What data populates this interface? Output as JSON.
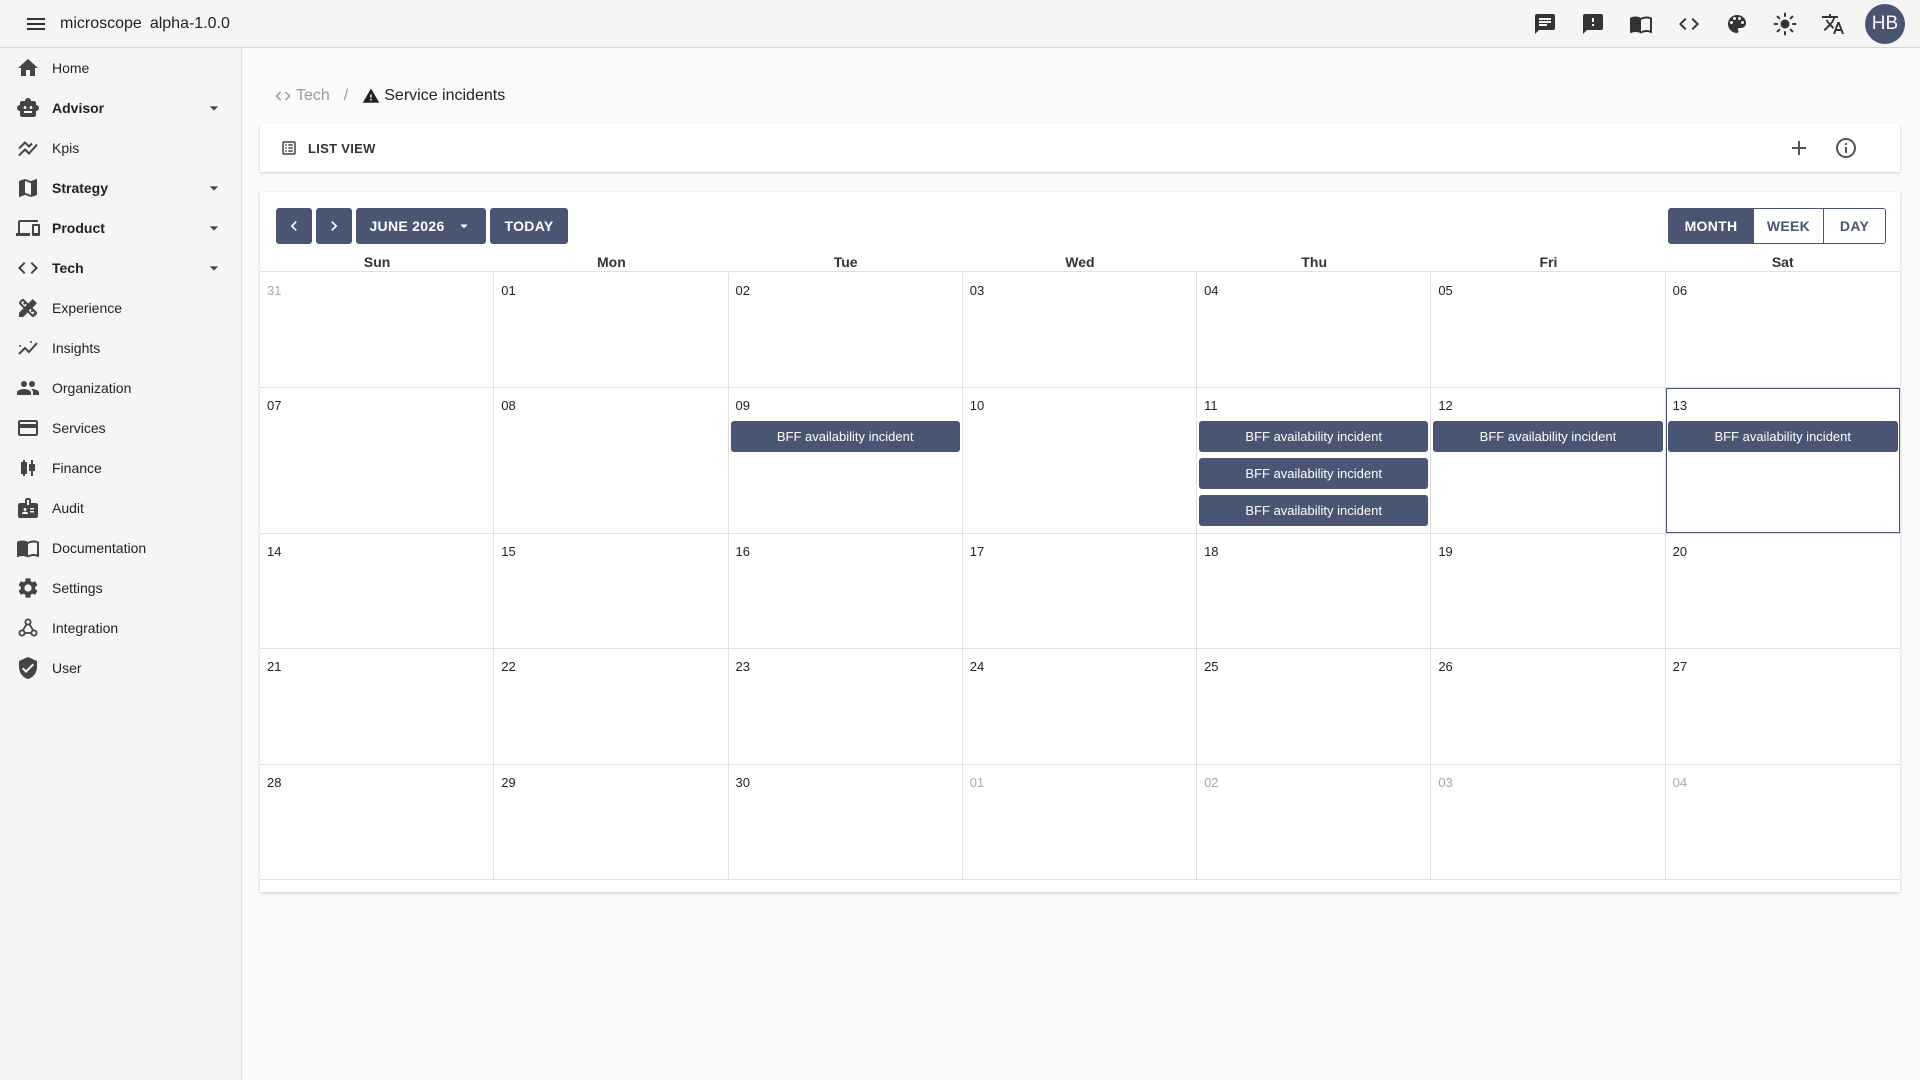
{
  "app": {
    "title": "microscope",
    "version": "alpha-1.0.0",
    "user_initials": "HB"
  },
  "topbar_icons": [
    "chat-icon",
    "feedback-icon",
    "book-icon",
    "code-icon",
    "palette-icon",
    "brightness-icon",
    "translate-icon"
  ],
  "sidebar": {
    "items": [
      {
        "label": "Home",
        "icon": "home-icon",
        "bold": false,
        "expandable": false
      },
      {
        "label": "Advisor",
        "icon": "robot-icon",
        "bold": true,
        "expandable": true
      },
      {
        "label": "Kpis",
        "icon": "kpi-chart-icon",
        "bold": false,
        "expandable": false
      },
      {
        "label": "Strategy",
        "icon": "map-icon",
        "bold": true,
        "expandable": true
      },
      {
        "label": "Product",
        "icon": "devices-icon",
        "bold": true,
        "expandable": true
      },
      {
        "label": "Tech",
        "icon": "code-icon",
        "bold": true,
        "expandable": true
      },
      {
        "label": "Experience",
        "icon": "design-tools-icon",
        "bold": false,
        "expandable": false
      },
      {
        "label": "Insights",
        "icon": "insights-icon",
        "bold": false,
        "expandable": false
      },
      {
        "label": "Organization",
        "icon": "people-icon",
        "bold": false,
        "expandable": false
      },
      {
        "label": "Services",
        "icon": "card-icon",
        "bold": false,
        "expandable": false
      },
      {
        "label": "Finance",
        "icon": "candlestick-icon",
        "bold": false,
        "expandable": false
      },
      {
        "label": "Audit",
        "icon": "badge-icon",
        "bold": false,
        "expandable": false
      },
      {
        "label": "Documentation",
        "icon": "book-icon",
        "bold": false,
        "expandable": false
      },
      {
        "label": "Settings",
        "icon": "gear-icon",
        "bold": false,
        "expandable": false
      },
      {
        "label": "Integration",
        "icon": "webhook-icon",
        "bold": false,
        "expandable": false
      },
      {
        "label": "User",
        "icon": "shield-icon",
        "bold": false,
        "expandable": false
      }
    ]
  },
  "breadcrumb": {
    "parent": "Tech",
    "separator": "/",
    "current": "Service incidents"
  },
  "toolbar": {
    "list_view_label": "LIST VIEW"
  },
  "calendar": {
    "month_label": "JUNE 2026",
    "today_label": "TODAY",
    "views": [
      {
        "label": "MONTH",
        "active": true
      },
      {
        "label": "WEEK",
        "active": false
      },
      {
        "label": "DAY",
        "active": false
      }
    ],
    "weekdays": [
      "Sun",
      "Mon",
      "Tue",
      "Wed",
      "Thu",
      "Fri",
      "Sat"
    ],
    "weeks": [
      [
        {
          "day": "31",
          "other": true
        },
        {
          "day": "01"
        },
        {
          "day": "02"
        },
        {
          "day": "03"
        },
        {
          "day": "04"
        },
        {
          "day": "05"
        },
        {
          "day": "06"
        }
      ],
      [
        {
          "day": "07"
        },
        {
          "day": "08"
        },
        {
          "day": "09",
          "events": [
            "BFF availability incident"
          ]
        },
        {
          "day": "10"
        },
        {
          "day": "11",
          "events": [
            "BFF availability incident",
            "BFF availability incident",
            "BFF availability incident"
          ]
        },
        {
          "day": "12",
          "events": [
            "BFF availability incident"
          ]
        },
        {
          "day": "13",
          "today": true,
          "events": [
            "BFF availability incident"
          ]
        }
      ],
      [
        {
          "day": "14"
        },
        {
          "day": "15"
        },
        {
          "day": "16"
        },
        {
          "day": "17"
        },
        {
          "day": "18"
        },
        {
          "day": "19"
        },
        {
          "day": "20"
        }
      ],
      [
        {
          "day": "21"
        },
        {
          "day": "22"
        },
        {
          "day": "23"
        },
        {
          "day": "24"
        },
        {
          "day": "25"
        },
        {
          "day": "26"
        },
        {
          "day": "27"
        }
      ],
      [
        {
          "day": "28"
        },
        {
          "day": "29"
        },
        {
          "day": "30"
        },
        {
          "day": "01",
          "other": true
        },
        {
          "day": "02",
          "other": true
        },
        {
          "day": "03",
          "other": true
        },
        {
          "day": "04",
          "other": true
        }
      ]
    ]
  },
  "colors": {
    "accent": "#4a5473",
    "sidebar_bg": "#f5f5f5",
    "page_bg": "#fafafa"
  }
}
